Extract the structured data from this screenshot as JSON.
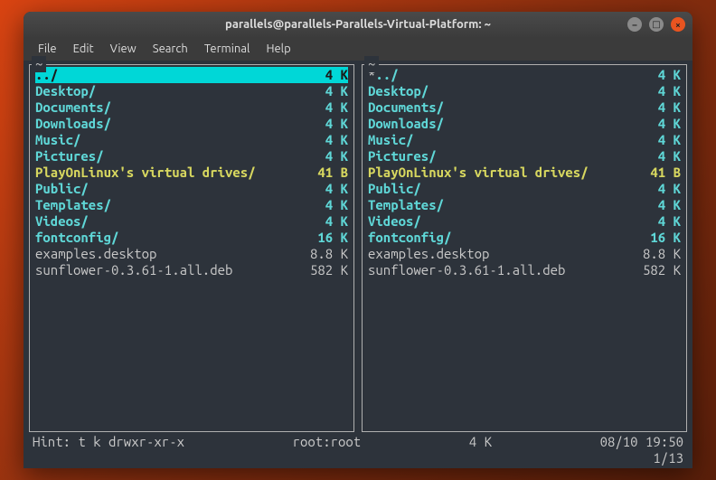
{
  "title": "parallels@parallels-Parallels-Virtual-Platform: ~",
  "menu": [
    "File",
    "Edit",
    "View",
    "Search",
    "Terminal",
    "Help"
  ],
  "left_panel": {
    "header": "~",
    "selected_index": 0,
    "items": [
      {
        "name": "../",
        "size": "4 K",
        "kind": "dir"
      },
      {
        "name": "Desktop/",
        "size": "4 K",
        "kind": "dir"
      },
      {
        "name": "Documents/",
        "size": "4 K",
        "kind": "dir"
      },
      {
        "name": "Downloads/",
        "size": "4 K",
        "kind": "dir"
      },
      {
        "name": "Music/",
        "size": "4 K",
        "kind": "dir"
      },
      {
        "name": "Pictures/",
        "size": "4 K",
        "kind": "dir"
      },
      {
        "name": "PlayOnLinux's virtual drives/",
        "size": "41 B",
        "kind": "link"
      },
      {
        "name": "Public/",
        "size": "4 K",
        "kind": "dir"
      },
      {
        "name": "Templates/",
        "size": "4 K",
        "kind": "dir"
      },
      {
        "name": "Videos/",
        "size": "4 K",
        "kind": "dir"
      },
      {
        "name": "fontconfig/",
        "size": "16 K",
        "kind": "dir"
      },
      {
        "name": "examples.desktop",
        "size": "8.8 K",
        "kind": "file"
      },
      {
        "name": "sunflower-0.3.61-1.all.deb",
        "size": "582 K",
        "kind": "file"
      }
    ]
  },
  "right_panel": {
    "header": "~",
    "star_prefix": true,
    "items": [
      {
        "name": "../",
        "size": "4 K",
        "kind": "dir"
      },
      {
        "name": "Desktop/",
        "size": "4 K",
        "kind": "dir"
      },
      {
        "name": "Documents/",
        "size": "4 K",
        "kind": "dir"
      },
      {
        "name": "Downloads/",
        "size": "4 K",
        "kind": "dir"
      },
      {
        "name": "Music/",
        "size": "4 K",
        "kind": "dir"
      },
      {
        "name": "Pictures/",
        "size": "4 K",
        "kind": "dir"
      },
      {
        "name": "PlayOnLinux's virtual drives/",
        "size": "41 B",
        "kind": "link"
      },
      {
        "name": "Public/",
        "size": "4 K",
        "kind": "dir"
      },
      {
        "name": "Templates/",
        "size": "4 K",
        "kind": "dir"
      },
      {
        "name": "Videos/",
        "size": "4 K",
        "kind": "dir"
      },
      {
        "name": "fontconfig/",
        "size": "16 K",
        "kind": "dir"
      },
      {
        "name": "examples.desktop",
        "size": "8.8 K",
        "kind": "file"
      },
      {
        "name": "sunflower-0.3.61-1.all.deb",
        "size": "582 K",
        "kind": "file"
      }
    ]
  },
  "status": {
    "hint": "Hint: t k drwxr-xr-x",
    "owner": "root:root",
    "size": "4 K",
    "date": "08/10 19:50"
  },
  "counter": "1/13"
}
